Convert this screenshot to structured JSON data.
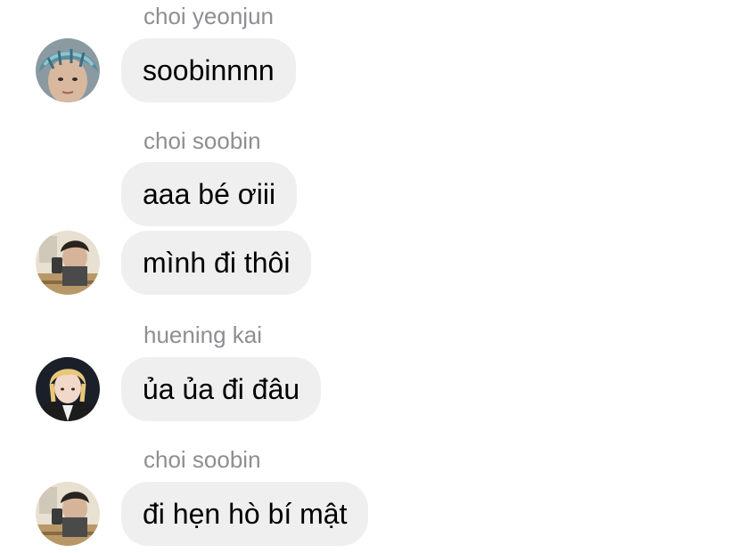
{
  "messages": [
    {
      "sender": "choi yeonjun",
      "bubbles": [
        "soobinnnn"
      ],
      "avatar_icon": "avatar-blue-hair"
    },
    {
      "sender": "choi soobin",
      "bubbles": [
        "aaa bé ơiii",
        "mình đi thôi"
      ],
      "avatar_icon": "avatar-dark-hair"
    },
    {
      "sender": "huening kai",
      "bubbles": [
        "ủa ủa đi đâu"
      ],
      "avatar_icon": "avatar-blonde-hair"
    },
    {
      "sender": "choi soobin",
      "bubbles": [
        "đi hẹn hò bí mật"
      ],
      "avatar_icon": "avatar-dark-hair"
    }
  ],
  "colors": {
    "bubble_bg": "#efeff0",
    "sender_name": "#8e8e93",
    "text": "#000000"
  }
}
